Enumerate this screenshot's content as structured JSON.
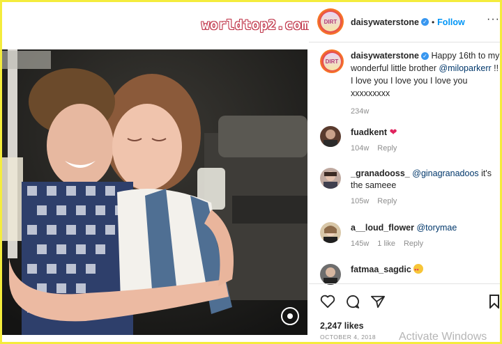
{
  "watermark": "worldtop2.com",
  "post": {
    "username": "daisywaterstone",
    "follow_label": "Follow",
    "more_icon": "more-dots-icon",
    "caption_prefix": "Happy 16th to my wonderful little brother ",
    "caption_mention": "@miloparkerr",
    "caption_suffix": " !! I love you I love you I love you xxxxxxxxx",
    "caption_age": "234w"
  },
  "comments": [
    {
      "user": "fuadkent",
      "text": "",
      "emoji": "red-heart-icon",
      "age": "104w",
      "likes": "",
      "reply": "Reply"
    },
    {
      "user": "_granadooss_",
      "mention": "@ginagranadoos",
      "text": " it's the sameee",
      "age": "105w",
      "likes": "",
      "reply": "Reply"
    },
    {
      "user": "a__loud_flower",
      "mention": "@torymae",
      "text": "",
      "age": "145w",
      "likes": "1 like",
      "reply": "Reply"
    },
    {
      "user": "fatmaa_sagdic",
      "text": "",
      "emoji": "heart-eyes-emoji",
      "age": "",
      "likes": "",
      "reply": ""
    }
  ],
  "footer": {
    "likes": "2,247 likes",
    "date": "OCTOBER 4, 2018"
  },
  "os_overlay": "Activate Windows",
  "colors": {
    "link": "#0095f6",
    "mention": "#00376b",
    "verified": "#3897f0",
    "border": "#f4ec3c"
  }
}
